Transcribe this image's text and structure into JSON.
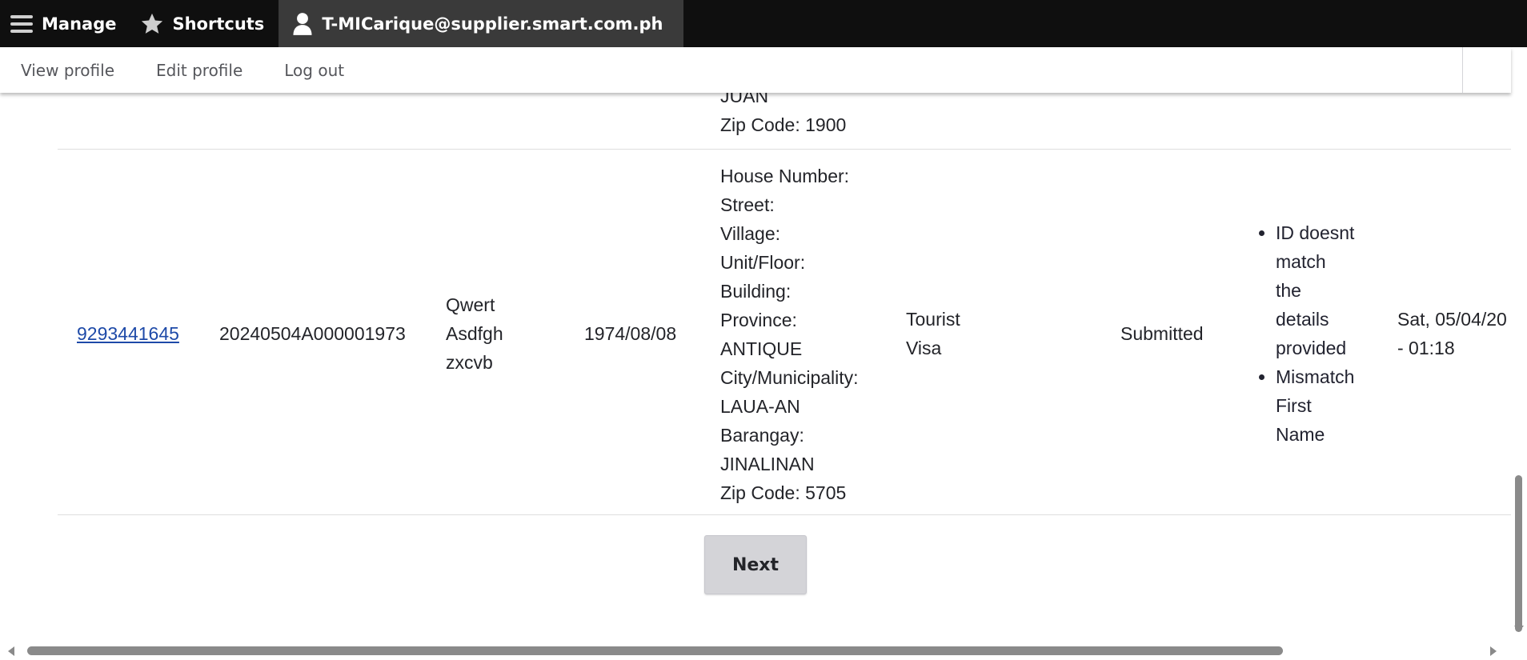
{
  "toolbar": {
    "manage_label": "Manage",
    "shortcuts_label": "Shortcuts",
    "user_label": "T-MICarique@supplier.smart.com.ph",
    "icons": {
      "manage": "hamburger-menu-icon",
      "shortcuts": "star-icon",
      "user": "user-icon"
    }
  },
  "tray": {
    "view_profile": "View profile",
    "edit_profile": "Edit profile",
    "log_out": "Log out"
  },
  "table": {
    "previous_row_tail": [
      "JUAN",
      "Zip Code: 1900"
    ],
    "row": {
      "msisdn": "9293441645",
      "reference": "20240504A000001973",
      "name_lines": [
        "Qwert",
        "Asdfgh",
        "zxcvb"
      ],
      "birthdate": "1974/08/08",
      "address_lines": [
        "House Number:",
        "Street:",
        "Village:",
        "Unit/Floor:",
        "Building:",
        "Province:",
        "ANTIQUE",
        "City/Municipality:",
        "LAUA-AN",
        "Barangay:",
        "JINALINAN",
        "Zip Code: 5705"
      ],
      "id_type_lines": [
        "Tourist",
        "Visa"
      ],
      "status": "Submitted",
      "remarks": [
        [
          "ID doesnt",
          "match",
          "the",
          "details",
          "provided"
        ],
        [
          "Mismatch",
          "First",
          "Name"
        ]
      ],
      "date_lines": [
        "Sat, 05/04/20",
        "- 01:18"
      ]
    }
  },
  "pager": {
    "next_label": "Next"
  },
  "colors": {
    "toolbar_bg": "#0f0f0f",
    "active_tab_bg": "#3a3a3a",
    "link": "#1e4aa8",
    "button_bg": "#d4d4d8"
  }
}
